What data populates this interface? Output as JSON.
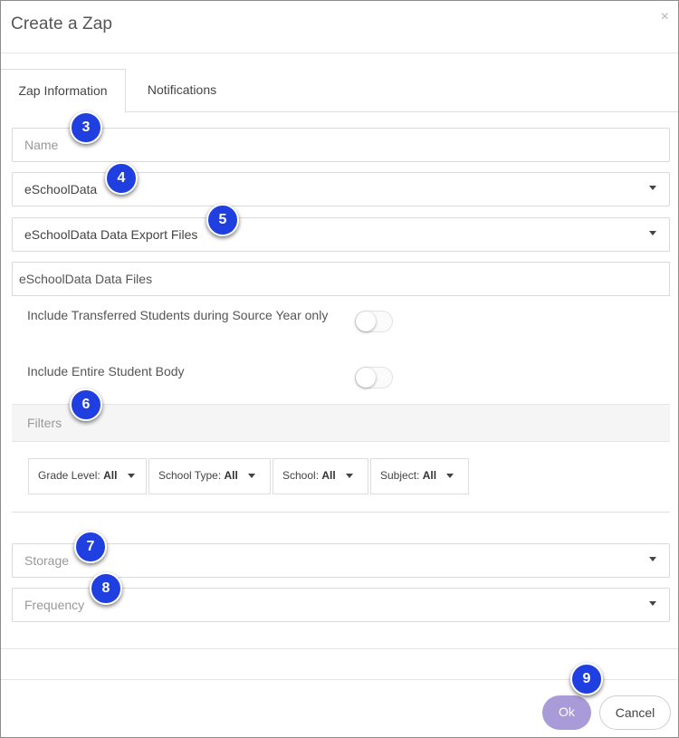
{
  "dialog": {
    "title": "Create a Zap",
    "close_label": "×"
  },
  "tabs": [
    {
      "label": "Zap Information",
      "active": true
    },
    {
      "label": "Notifications",
      "active": false
    }
  ],
  "form": {
    "name_placeholder": "Name",
    "source_value": "eSchoolData",
    "export_type_value": "eSchoolData Data Export Files",
    "data_files_value": "eSchoolData Data Files",
    "toggle_transferred_label": "Include Transferred Students during Source Year only",
    "toggle_transferred_on": false,
    "toggle_entire_label": "Include Entire Student Body",
    "toggle_entire_on": false,
    "storage_placeholder": "Storage",
    "frequency_placeholder": "Frequency"
  },
  "filters": {
    "title": "Filters",
    "items": [
      {
        "key": "Grade Level:",
        "value": "All"
      },
      {
        "key": "School Type:",
        "value": "All"
      },
      {
        "key": "School:",
        "value": "All"
      },
      {
        "key": "Subject:",
        "value": "All"
      }
    ]
  },
  "footer": {
    "ok_label": "Ok",
    "cancel_label": "Cancel"
  },
  "callouts": [
    "3",
    "4",
    "5",
    "6",
    "7",
    "8",
    "9"
  ],
  "colors": {
    "callout_badge": "#1f3fe0",
    "ok_button": "#a99ad8",
    "filters_header_bg": "#f5f5f5"
  }
}
